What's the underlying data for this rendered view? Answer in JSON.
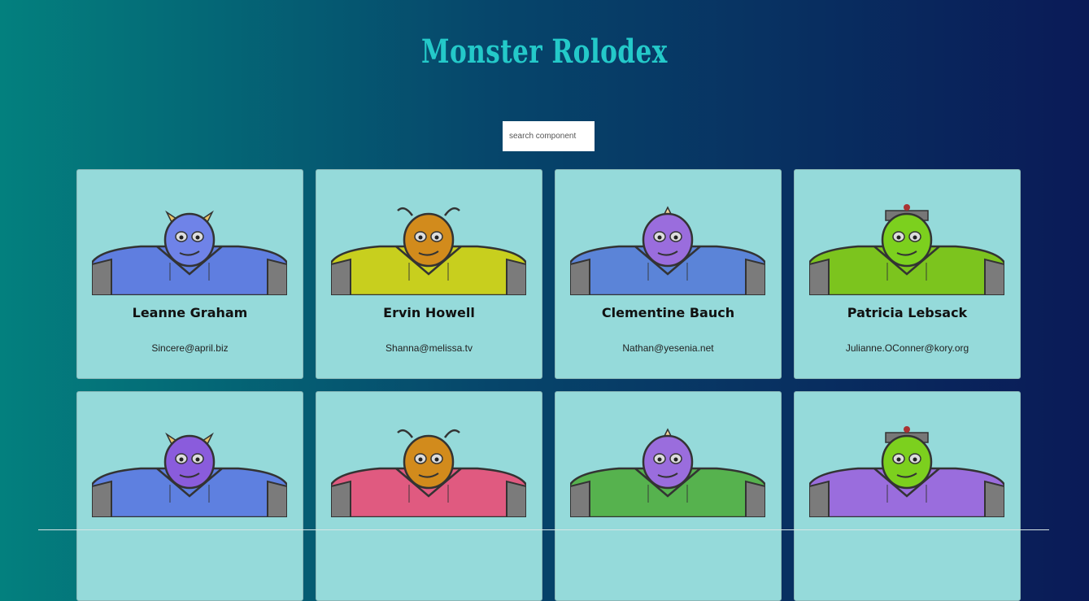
{
  "title": "Monster Rolodex",
  "search": {
    "placeholder": "search component",
    "value": ""
  },
  "monsters": [
    {
      "name": "Leanne Graham",
      "email": "Sincere@april.biz",
      "head": "#6f83e8",
      "body": "#5f7ee0",
      "icon": "blue-horned-monster-icon"
    },
    {
      "name": "Ervin Howell",
      "email": "Shanna@melissa.tv",
      "head": "#d28b1c",
      "body": "#c8cf1e",
      "icon": "orange-spiky-monster-icon"
    },
    {
      "name": "Clementine Bauch",
      "email": "Nathan@yesenia.net",
      "head": "#9a6ddd",
      "body": "#5b84d8",
      "icon": "purple-cyclops-monster-icon"
    },
    {
      "name": "Patricia Lebsack",
      "email": "Julianne.OConner@kory.org",
      "head": "#7cd01e",
      "body": "#7cc41e",
      "icon": "green-robot-monster-icon"
    },
    {
      "name": "",
      "email": "",
      "head": "#8a5cdc",
      "body": "#5e80e0",
      "icon": "purple-robot-monster-icon"
    },
    {
      "name": "",
      "email": "",
      "head": "#d28b1c",
      "body": "#e05a80",
      "icon": "orange-antenna-monster-icon"
    },
    {
      "name": "",
      "email": "",
      "head": "#9a6ddd",
      "body": "#56b24e",
      "icon": "purple-horned-monster-icon"
    },
    {
      "name": "",
      "email": "",
      "head": "#7cd01e",
      "body": "#9a6ddd",
      "icon": "green-robot-monster-icon"
    }
  ]
}
